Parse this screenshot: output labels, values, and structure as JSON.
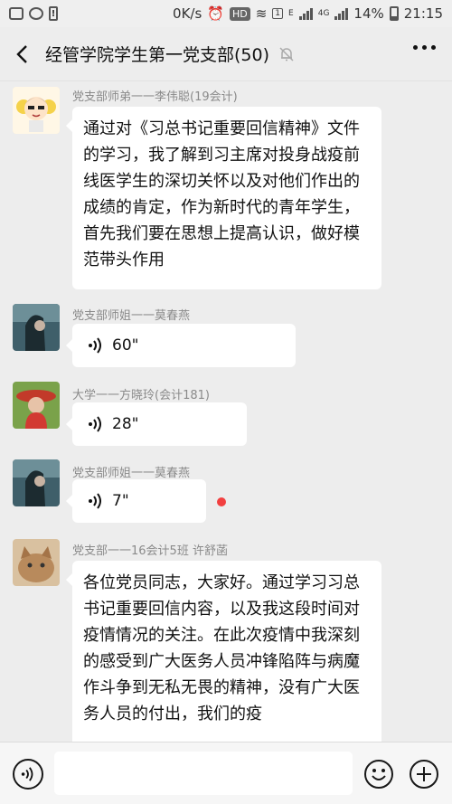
{
  "status_bar": {
    "speed": "0K/s",
    "hd": "HD",
    "sim": "1",
    "e": "E",
    "net": "4G",
    "battery": "14%",
    "time": "21:15"
  },
  "header": {
    "title": "经管学院学生第一党支部(50)",
    "mute_icon": "mute-bell-icon",
    "more_icon": "more-dots-icon"
  },
  "messages": [
    {
      "sender": "党支部师弟一一李伟聪(19会计)",
      "type": "text",
      "text": "通过对《习总书记重要回信精神》文件的学习，我了解到习主席对投身战疫前线医学生的深切关怀以及对他们作出的成绩的肯定，作为新时代的青年学生，首先我们要在思想上提高认识，做好模范带头作用"
    },
    {
      "sender": "党支部师姐一一莫春燕",
      "type": "voice",
      "duration": "60\""
    },
    {
      "sender": "大学一一方晓玲(会计181)",
      "type": "voice",
      "duration": "28\""
    },
    {
      "sender": "党支部师姐一一莫春燕",
      "type": "voice",
      "duration": "7\"",
      "unread": true
    },
    {
      "sender": "党支部一一16会计5班 许舒菡",
      "type": "text",
      "text": "各位党员同志，大家好。通过学习习总书记重要回信内容，以及我这段时间对疫情情况的关注。在此次疫情中我深刻的感受到广大医务人员冲锋陷阵与病魔作斗争到无私无畏的精神，没有广大医务人员的付出，我们的疫"
    }
  ],
  "input_bar": {
    "voice_icon": "voice-mode-icon",
    "emoji_icon": "emoji-icon",
    "plus_icon": "plus-icon",
    "input_value": ""
  },
  "colors": {
    "background": "#ededed",
    "bubble": "#ffffff",
    "unread_dot": "#f24040"
  }
}
